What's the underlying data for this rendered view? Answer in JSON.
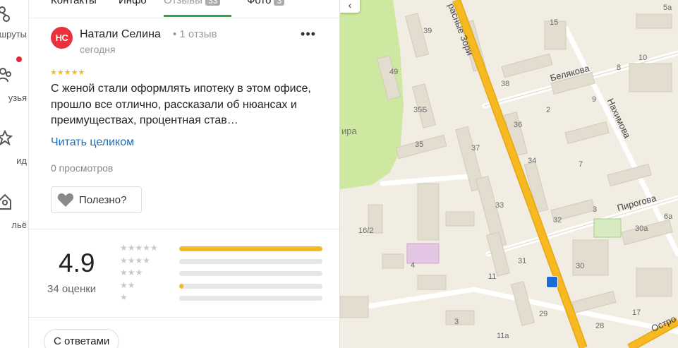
{
  "rail": {
    "items": [
      {
        "label": "шруты",
        "icon": "route-icon"
      },
      {
        "label": "узья",
        "icon": "friends-icon"
      },
      {
        "label": "ид",
        "icon": "guide-icon"
      },
      {
        "label": "льё",
        "icon": "apartment-icon"
      }
    ]
  },
  "tabs": [
    {
      "label": "Контакты"
    },
    {
      "label": "Инфо"
    },
    {
      "label": "Отзывы",
      "badge": "33"
    },
    {
      "label": "Фото",
      "badge": "3"
    }
  ],
  "review": {
    "avatar_initials": "НС",
    "author": "Натали Селина",
    "review_count": "• 1 отзыв",
    "date": "сегодня",
    "stars": "★★★★★",
    "text": "С женой стали оформлять ипотеку в этом офисе, прошло все отлично, рассказали об нюансах и преимуществах, процентная став…",
    "read_more": "Читать целиком",
    "views": "0 просмотров",
    "helpful": "Полезно?",
    "more": "•••"
  },
  "summary": {
    "rating": "4.9",
    "count": "34 оценки",
    "distribution": [
      {
        "stars": "★★★★★",
        "fraction": 1.0
      },
      {
        "stars": "★★★★",
        "fraction": 0.0
      },
      {
        "stars": "★★★",
        "fraction": 0.0
      },
      {
        "stars": "★★",
        "fraction": 0.03
      },
      {
        "stars": "★",
        "fraction": 0.0
      }
    ]
  },
  "filters": {
    "with_answers": "С ответами"
  },
  "map": {
    "streets": [
      "Белякова",
      "Нахимова",
      "Пирогова",
      "расные Зори",
      "Остро"
    ],
    "houses": [
      "39",
      "49",
      "35Б",
      "35",
      "37",
      "38",
      "36",
      "34",
      "33",
      "32",
      "31",
      "29",
      "30",
      "28",
      "16/2",
      "11",
      "11а",
      "3",
      "4",
      "2",
      "3",
      "7",
      "8",
      "9",
      "10",
      "15",
      "17",
      "5а",
      "6а",
      "30а",
      "ира"
    ],
    "colors": {
      "road_main": "#f6b922",
      "park": "#cde8a0",
      "building": "#e3ddcf",
      "background": "#f1ede3"
    }
  }
}
